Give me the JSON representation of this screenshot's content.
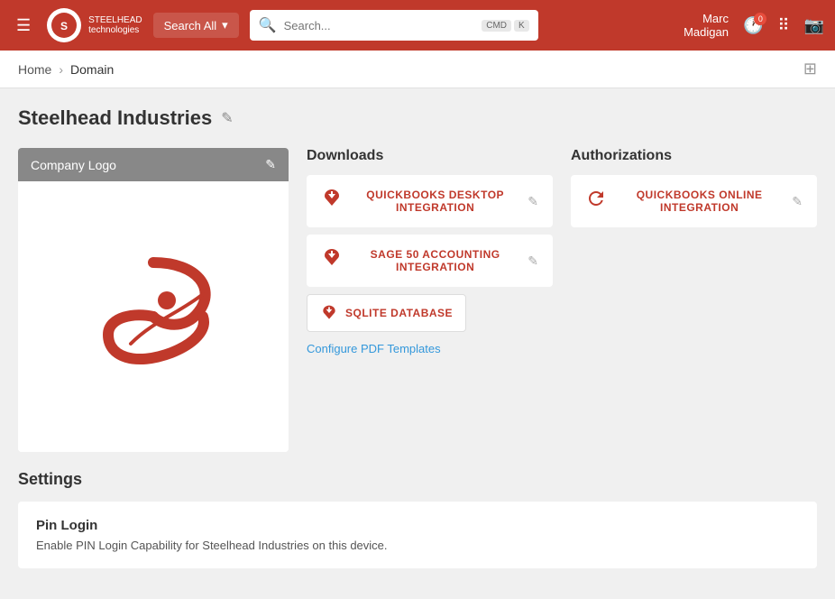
{
  "header": {
    "menu_icon": "☰",
    "logo_alt": "Steelhead Technologies",
    "logo_abbr": "SH",
    "brand_name": "STEELHEAD",
    "brand_sub": "technologies",
    "search_all_label": "Search All",
    "search_placeholder": "Search...",
    "kbd_cmd": "CMD",
    "kbd_k": "K",
    "user_name": "Marc",
    "user_last": "Madigan",
    "notification_count": "0",
    "clock_icon": "🕐",
    "grid_icon": "⠿",
    "camera_icon": "📷"
  },
  "breadcrumb": {
    "home_label": "Home",
    "separator": "›",
    "current": "Domain",
    "star_icon": "⊞"
  },
  "page": {
    "title": "Steelhead Industries",
    "edit_icon": "✎"
  },
  "logo_card": {
    "header_label": "Company Logo",
    "edit_icon": "✎"
  },
  "downloads": {
    "title": "Downloads",
    "items": [
      {
        "id": "quickbooks-desktop",
        "label": "QUICKBOOKS DESKTOP INTEGRATION",
        "icon": "download"
      },
      {
        "id": "sage-50",
        "label": "SAGE 50 ACCOUNTING INTEGRATION",
        "icon": "download"
      }
    ],
    "sqlite_label": "SQLITE DATABASE",
    "configure_pdf_label": "Configure PDF Templates"
  },
  "authorizations": {
    "title": "Authorizations",
    "items": [
      {
        "id": "quickbooks-online",
        "label": "QUICKBOOKS ONLINE INTEGRATION",
        "icon": "refresh"
      }
    ]
  },
  "settings": {
    "title": "Settings",
    "cards": [
      {
        "title": "Pin Login",
        "description": "Enable PIN Login Capability for Steelhead Industries on this device."
      }
    ]
  }
}
